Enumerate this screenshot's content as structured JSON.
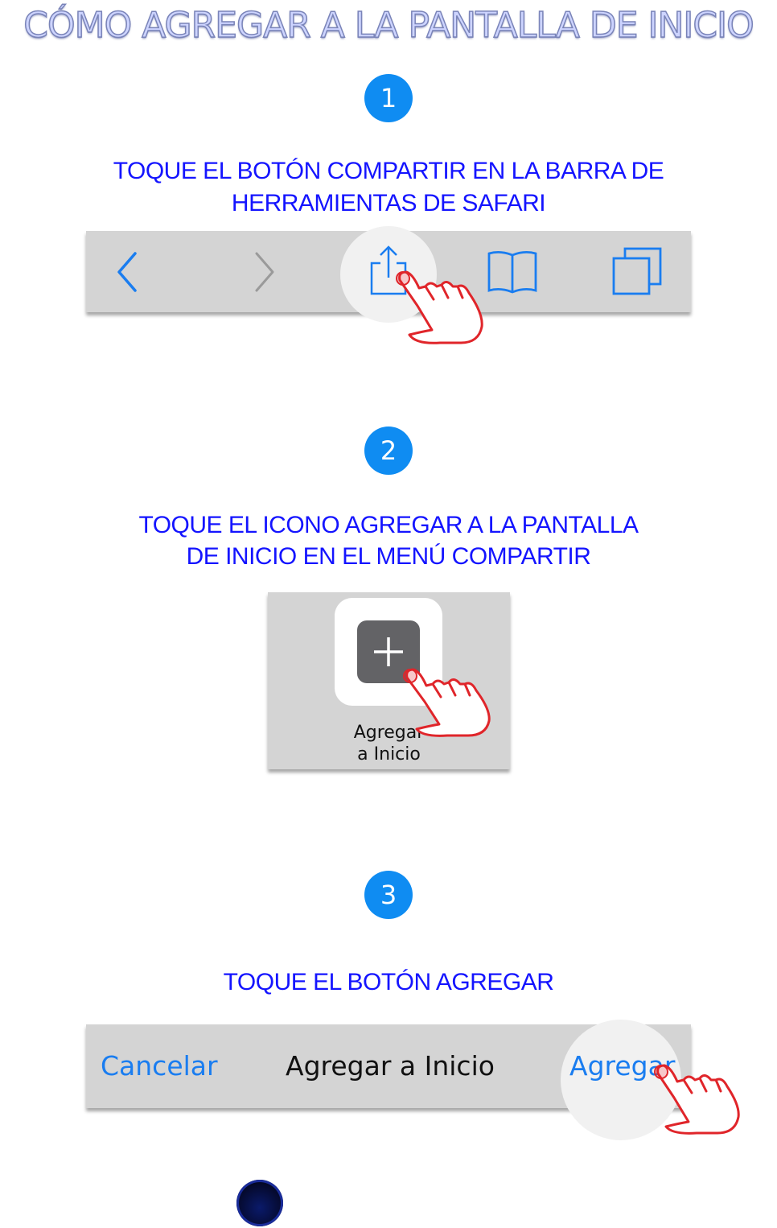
{
  "title": "CÓMO AGREGAR A LA PANTALLA DE INICIO",
  "steps": [
    {
      "number": "1",
      "instruction_line1": "TOQUE EL BOTÓN COMPARTIR EN LA BARRA DE",
      "instruction_line2": "HERRAMIENTAS DE SAFARI"
    },
    {
      "number": "2",
      "instruction_line1": "TOQUE EL ICONO AGREGAR A LA PANTALLA",
      "instruction_line2": "DE INICIO EN EL MENÚ COMPARTIR",
      "tile_label_line1": "Agregar",
      "tile_label_line2": "a Inicio"
    },
    {
      "number": "3",
      "instruction_line1": "TOQUE EL BOTÓN AGREGAR",
      "cancel_label": "Cancelar",
      "dialog_title": "Agregar a Inicio",
      "add_label": "Agregar"
    }
  ],
  "colors": {
    "step_circle": "#0f8cf2",
    "instruction_text": "#1414ff",
    "ios_blue": "#1a7df0",
    "hand_outline": "#e0252a",
    "panel_bg": "#d4d4d4"
  },
  "icons": [
    "back-chevron-icon",
    "forward-chevron-icon",
    "share-icon",
    "bookmarks-icon",
    "tabs-icon",
    "add-plus-icon",
    "pointing-hand-icon"
  ]
}
